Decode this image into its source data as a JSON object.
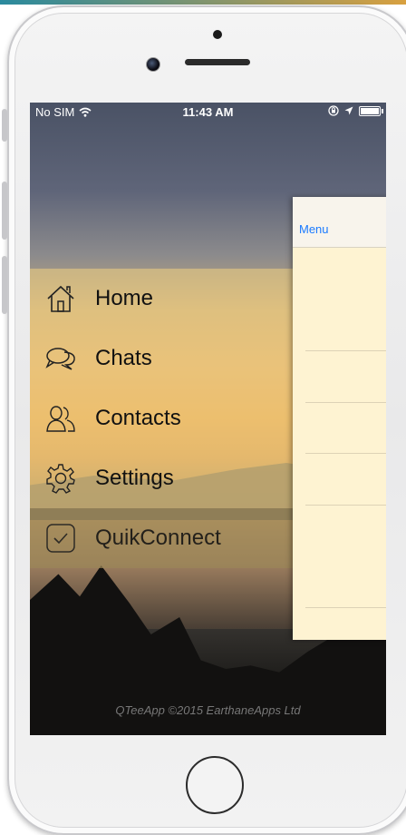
{
  "status_bar": {
    "carrier": "No SIM",
    "time": "11:43 AM"
  },
  "menu": {
    "items": [
      {
        "label": "Home",
        "icon": "home-icon"
      },
      {
        "label": "Chats",
        "icon": "chat-bubbles-icon"
      },
      {
        "label": "Contacts",
        "icon": "contacts-icon"
      },
      {
        "label": "Settings",
        "icon": "gear-icon"
      },
      {
        "label": "QuikConnect",
        "icon": "checkbox-icon"
      }
    ]
  },
  "detail": {
    "nav_title": "Menu"
  },
  "footer": {
    "text": "QTeeApp ©2015 EarthaneApps Ltd"
  },
  "colors": {
    "nav_tint": "#1a7aff",
    "detail_background": "#fef3d2",
    "menu_overlay": "#f0d282"
  }
}
